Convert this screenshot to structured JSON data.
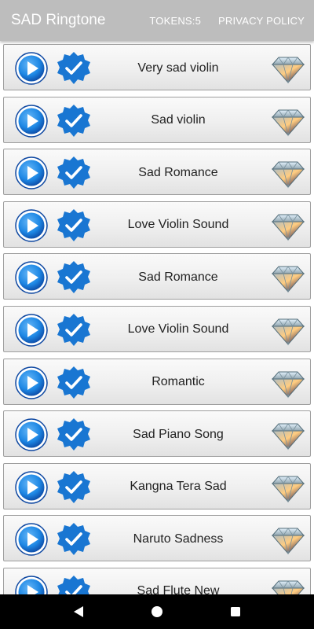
{
  "app": {
    "title": "SAD Ringtone",
    "tokens_label": "TOKENS:5",
    "privacy_label": "PRIVACY POLICY"
  },
  "colors": {
    "appbar": "#bdbdbd",
    "play_blue": "#1e88e5",
    "check_blue": "#1976d2",
    "navbar": "#000000"
  },
  "icons": {
    "play": "play-circle-icon",
    "set": "verified-check-icon",
    "premium": "diamond-icon"
  },
  "ringtones": [
    {
      "name": "Very sad violin"
    },
    {
      "name": "Sad violin"
    },
    {
      "name": "Sad Romance"
    },
    {
      "name": "Love Violin Sound"
    },
    {
      "name": "Sad Romance"
    },
    {
      "name": "Love Violin Sound"
    },
    {
      "name": "Romantic"
    },
    {
      "name": "Sad Piano Song"
    },
    {
      "name": "Kangna Tera Sad"
    },
    {
      "name": "Naruto Sadness"
    },
    {
      "name": "Sad Flute New"
    }
  ],
  "navbar": {
    "back": "back-triangle-icon",
    "home": "home-circle-icon",
    "recents": "recents-square-icon"
  }
}
